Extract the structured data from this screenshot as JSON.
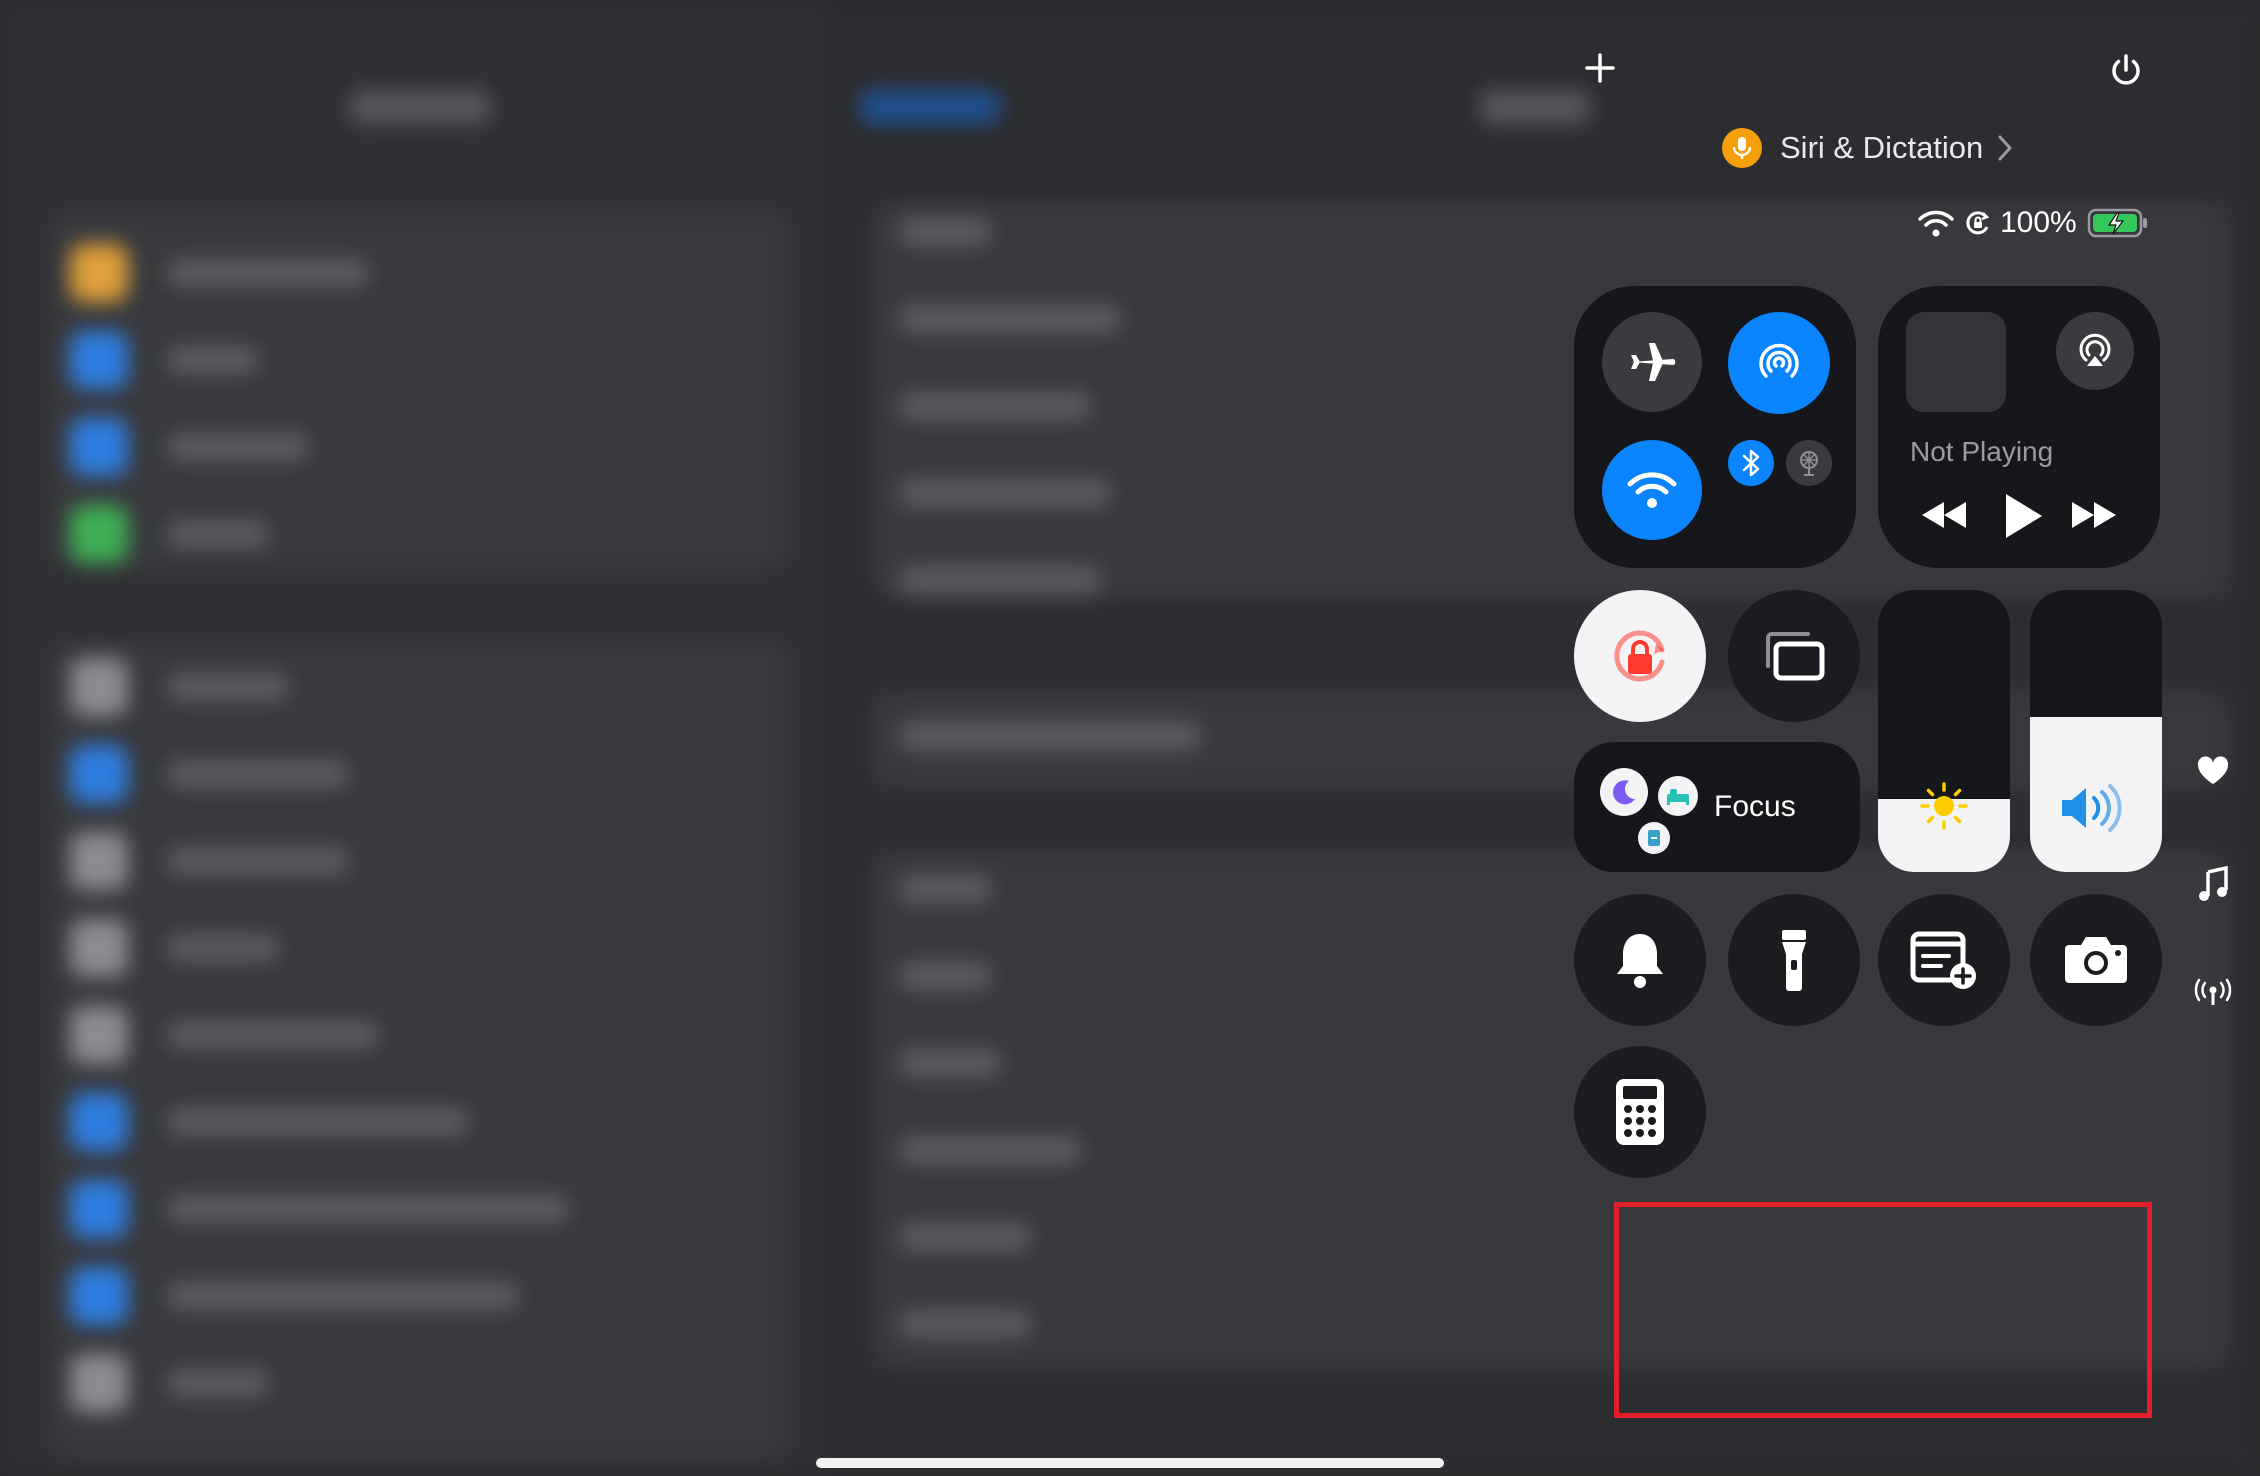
{
  "control_center": {
    "siri_label": "Siri & Dictation",
    "battery_percent": "100%",
    "now_playing": "Not Playing",
    "focus_label": "Focus"
  },
  "sliders": {
    "brightness_level": 0.26,
    "volume_level": 0.55
  },
  "colors": {
    "accent_blue": "#0a84ff",
    "siri_orange": "#f59e0b",
    "highlight_red": "#e41e26",
    "lock_red": "#ff3b30",
    "battery_green": "#34c759"
  },
  "icons": {
    "add": "plus-icon",
    "power": "power-icon",
    "airplane": "airplane-icon",
    "airdrop": "airdrop-icon",
    "wifi": "wifi-icon",
    "bluetooth": "bluetooth-icon",
    "satellite": "satellite-icon",
    "airplay": "airplay-icon",
    "rotation_lock": "rotation-lock-icon",
    "screen_mirror": "screen-mirroring-icon",
    "bell": "bell-icon",
    "flashlight": "flashlight-icon",
    "quick_note": "quick-note-icon",
    "camera": "camera-icon",
    "calculator": "calculator-icon",
    "heart": "heart-icon",
    "music": "music-icon",
    "signal": "signal-icon"
  }
}
